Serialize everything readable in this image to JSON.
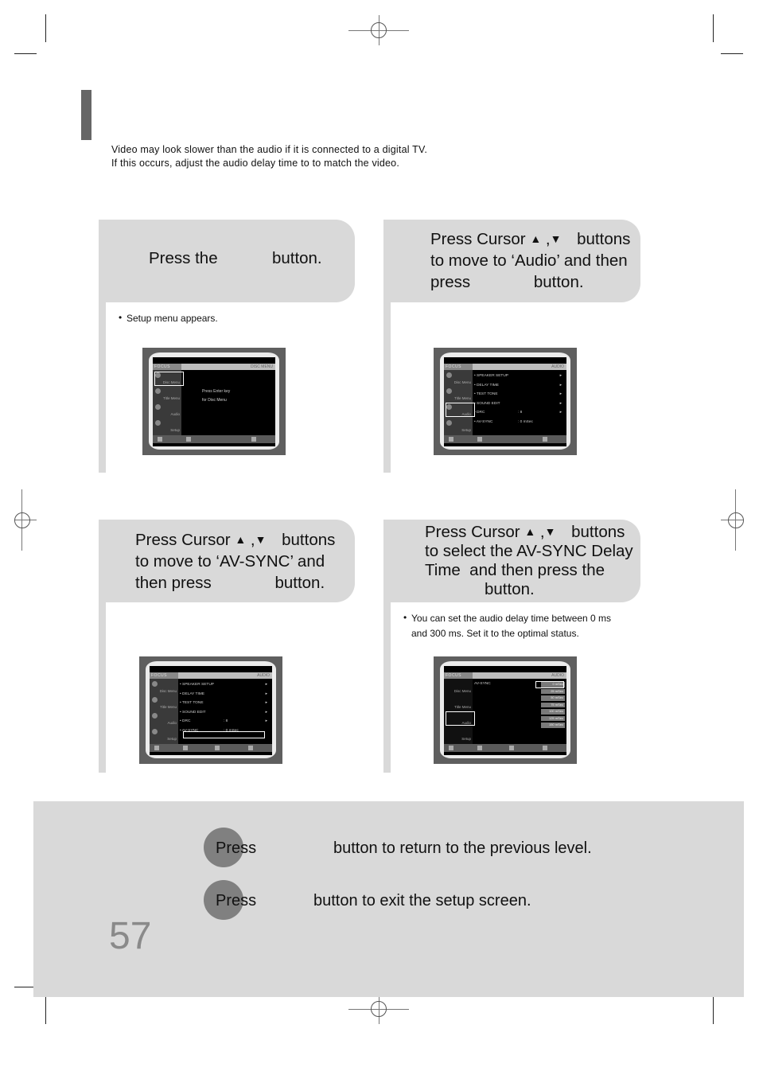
{
  "intro": {
    "line1": "Video may look slower than the audio if it is connected to a digital TV.",
    "line2": "If this occurs, adjust the audio delay time to to match the video."
  },
  "steps": [
    {
      "lines": [
        "Press the            button."
      ],
      "note": "Setup menu appears.",
      "screen": {
        "header_left": "FOCUS",
        "header_right": "DISC MENU",
        "side": [
          "Disc Menu",
          "Title Menu",
          "Audio",
          "Setup"
        ],
        "main_lines": [
          "Press Enter key",
          "for Disc Menu"
        ],
        "selected_side": "Disc Menu"
      }
    },
    {
      "lines": [
        "Press Cursor ",
        " buttons",
        "to move to ‘Audio’ and then",
        "press              button."
      ],
      "screen": {
        "header_left": "FOCUS",
        "header_right": "AUDIO",
        "side": [
          "Disc Menu",
          "Title Menu",
          "Audio",
          "Setup"
        ],
        "selected_side": "Audio",
        "rows": [
          {
            "label": "• SPEAKER SETUP",
            "value": "",
            "arrow": "▸"
          },
          {
            "label": "• DELAY TIME",
            "value": "",
            "arrow": "▸"
          },
          {
            "label": "• TEST TONE",
            "value": "",
            "arrow": "▸"
          },
          {
            "label": "• SOUND EDIT",
            "value": "",
            "arrow": "▸"
          },
          {
            "label": "• DRC",
            "value": ": 8",
            "arrow": "▸"
          },
          {
            "label": "• AV-SYNC",
            "value": ": 0 mSec",
            "arrow": ""
          }
        ]
      }
    },
    {
      "lines": [
        "Press Cursor ",
        " buttons",
        "to move to ‘AV-SYNC’ and",
        "then press              button."
      ],
      "screen": {
        "header_left": "FOCUS",
        "header_right": "AUDIO",
        "side": [
          "Disc Menu",
          "Title Menu",
          "Audio",
          "Setup"
        ],
        "selected_row": "AV-SYNC",
        "rows": [
          {
            "label": "• SPEAKER SETUP",
            "value": "",
            "arrow": "▸"
          },
          {
            "label": "• DELAY TIME",
            "value": "",
            "arrow": "▸"
          },
          {
            "label": "• TEST TONE",
            "value": "",
            "arrow": "▸"
          },
          {
            "label": "• SOUND EDIT",
            "value": "",
            "arrow": "▸"
          },
          {
            "label": "• DRC",
            "value": ": 8",
            "arrow": "▸"
          },
          {
            "label": "• AV-SYNC",
            "value": ": 0 mSec",
            "arrow": ""
          }
        ]
      }
    },
    {
      "lines": [
        "Press Cursor ",
        " buttons",
        "to select the AV-SYNC Delay",
        "Time  and then press the",
        "button."
      ],
      "note_line1": "You can set the audio delay time between 0 ms",
      "note_line2": "and 300 ms. Set it to the optimal status.",
      "screen": {
        "header_left": "FOCUS",
        "header_right": "AUDIO",
        "side": [
          "Disc Menu",
          "Title Menu",
          "Audio",
          "Setup"
        ],
        "selected_side": "Audio",
        "main_label": "AV-SYNC",
        "options": [
          "0 mSec",
          "25 mSec",
          "50 mSec",
          "75 mSec",
          "100 mSec",
          "125 mSec",
          "150 mSec"
        ],
        "selected_option": "0 mSec"
      }
    }
  ],
  "cursor_up_glyph": "▲",
  "cursor_down_glyph": "▼",
  "bottom": {
    "row1_press": "Press",
    "row1_text": "button to return to the previous level.",
    "row2_press": "Press",
    "row2_text": "button to exit the setup screen."
  },
  "page_number": "57"
}
